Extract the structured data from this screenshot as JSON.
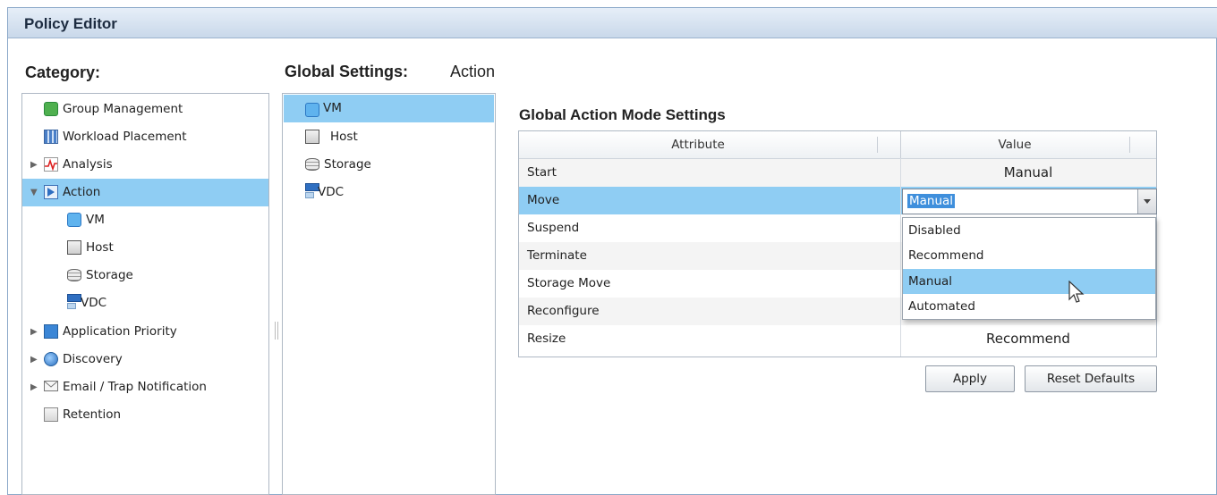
{
  "window": {
    "title": "Policy Editor"
  },
  "category": {
    "heading": "Category:",
    "items": [
      {
        "label": "Group Management",
        "icon": "group-management-icon"
      },
      {
        "label": "Workload Placement",
        "icon": "workload-placement-icon"
      },
      {
        "label": "Analysis",
        "icon": "analysis-icon"
      },
      {
        "label": "Action",
        "icon": "action-icon"
      },
      {
        "label": "VM",
        "icon": "vm-icon"
      },
      {
        "label": "Host",
        "icon": "host-icon"
      },
      {
        "label": "Storage",
        "icon": "storage-icon"
      },
      {
        "label": "VDC",
        "icon": "vdc-icon"
      },
      {
        "label": "Application Priority",
        "icon": "application-priority-icon"
      },
      {
        "label": "Discovery",
        "icon": "discovery-icon"
      },
      {
        "label": "Email / Trap Notification",
        "icon": "email-icon"
      },
      {
        "label": "Retention",
        "icon": "retention-icon"
      }
    ]
  },
  "global_settings": {
    "heading": "Global Settings:",
    "subheading": "Action",
    "items": [
      {
        "label": "VM",
        "icon": "vm-icon"
      },
      {
        "label": "Host",
        "icon": "host-icon"
      },
      {
        "label": "Storage",
        "icon": "storage-icon"
      },
      {
        "label": "VDC",
        "icon": "vdc-icon"
      }
    ]
  },
  "action_mode": {
    "heading": "Global Action Mode Settings",
    "columns": [
      "Attribute",
      "Value"
    ],
    "rows": [
      {
        "attribute": "Start",
        "value": "Manual"
      },
      {
        "attribute": "Move",
        "value": "Manual"
      },
      {
        "attribute": "Suspend",
        "value": ""
      },
      {
        "attribute": "Terminate",
        "value": ""
      },
      {
        "attribute": "Storage Move",
        "value": ""
      },
      {
        "attribute": "Reconfigure",
        "value": ""
      },
      {
        "attribute": "Resize",
        "value": "Recommend"
      }
    ],
    "dropdown_options": [
      "Disabled",
      "Recommend",
      "Manual",
      "Automated"
    ]
  },
  "buttons": {
    "apply": "Apply",
    "reset": "Reset Defaults"
  },
  "colors": {
    "selection": "#8fcdf3",
    "window_border": "#8aa8c8"
  }
}
